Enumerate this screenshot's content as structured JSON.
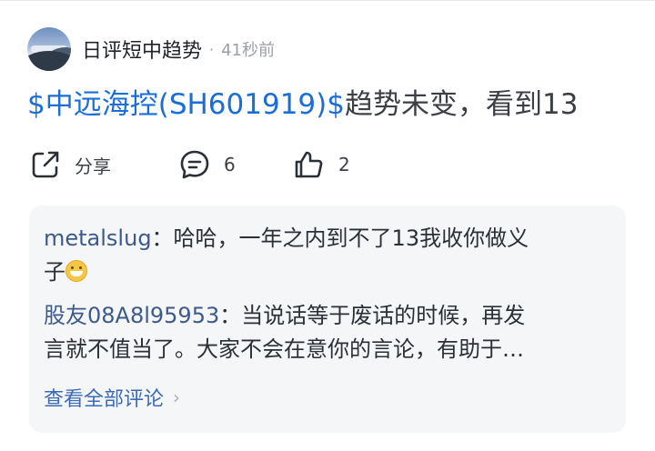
{
  "post": {
    "author": "日评短中趋势",
    "separator": "·",
    "time": "41秒前",
    "stock_tag": "$中远海控(SH601919)$",
    "text": "趋势未变，看到13"
  },
  "actions": {
    "share_label": "分享",
    "comment_count": "6",
    "like_count": "2"
  },
  "comments": [
    {
      "user": "metalslug",
      "sep": "：",
      "line1": "哈哈，一年之内到不了13我收你做义",
      "line2": "子",
      "emoji": "grinning-squinting-face-icon"
    },
    {
      "user": "股友08A8l95953",
      "sep": "：",
      "line1": "当说话等于废话的时候，再发",
      "line2": "言就不值当了。大家不会在意你的言论，有助于…"
    }
  ],
  "view_all_label": "查看全部评论"
}
